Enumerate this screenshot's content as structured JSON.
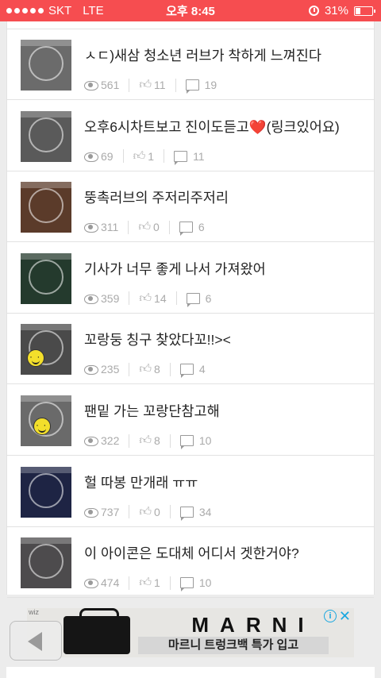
{
  "status_bar": {
    "carrier": "SKT",
    "network": "LTE",
    "time": "오후 8:45",
    "battery": "31%",
    "battery_level": 0.31
  },
  "posts": [
    {
      "title": "ㅅㄷ)새삼 청소년 러브가 착하게 느껴진다",
      "views": "561",
      "likes": "11",
      "comments": "19"
    },
    {
      "title": "오후6시차트보고 진이도듣고❤️(링크있어요)",
      "views": "69",
      "likes": "1",
      "comments": "11"
    },
    {
      "title": "뚱촉러브의 주저리주저리",
      "views": "311",
      "likes": "0",
      "comments": "6"
    },
    {
      "title": "기사가 너무 좋게 나서 가져왔어",
      "views": "359",
      "likes": "14",
      "comments": "6"
    },
    {
      "title": "꼬랑둥 칭구 찾았다꼬!!><",
      "views": "235",
      "likes": "8",
      "comments": "4"
    },
    {
      "title": "팬밑 가는 꼬랑단참고해",
      "views": "322",
      "likes": "8",
      "comments": "10"
    },
    {
      "title": "헐 따봉 만개래 ㅠㅠ",
      "views": "737",
      "likes": "0",
      "comments": "34"
    },
    {
      "title": "이 아이콘은 도대체 어디서 겟한거야?",
      "views": "474",
      "likes": "1",
      "comments": "10"
    }
  ],
  "ad": {
    "brand": "MARNI",
    "text": "마르니 트렁크백 특가 입고",
    "label": "wiz",
    "info": "i",
    "close": "✕"
  }
}
